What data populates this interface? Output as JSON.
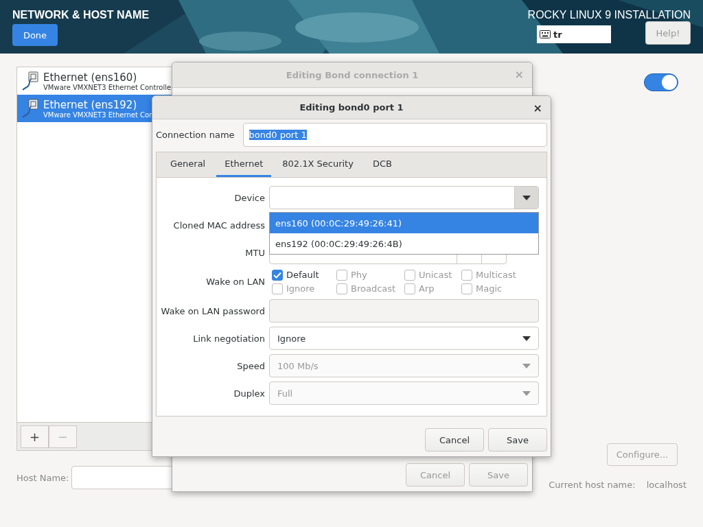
{
  "header": {
    "title": "NETWORK & HOST NAME",
    "done_button": "Done",
    "installer_title": "ROCKY LINUX 9 INSTALLATION",
    "keyboard_layout": "tr",
    "help_button": "Help!"
  },
  "connections": [
    {
      "name": "Ethernet (ens160)",
      "description": "VMware VMXNET3 Ethernet Controlle",
      "selected": false
    },
    {
      "name": "Ethernet (ens192)",
      "description": "VMware VMXNET3 Ethernet Con",
      "selected": true
    }
  ],
  "list_toolbar": {
    "add_button": "+",
    "remove_button": "−",
    "remove_disabled": true
  },
  "network_switch": {
    "on": true
  },
  "configure_button": {
    "label": "Configure...",
    "disabled": true
  },
  "host_name": {
    "label": "Host Name:",
    "current_label": "Current host name:",
    "current_value": "localhost"
  },
  "back_dialog": {
    "title": "Editing Bond connection 1",
    "close": "×",
    "buttons": [
      {
        "label": "Cancel",
        "disabled": true
      },
      {
        "label": "Save",
        "disabled": true
      }
    ]
  },
  "dialog": {
    "title": "Editing bond0 port 1",
    "close": "×",
    "connection_name": {
      "label": "Connection name",
      "value": "bond0 port 1",
      "text_selected": true
    },
    "tabs": [
      {
        "label": "General",
        "selected": false
      },
      {
        "label": "Ethernet",
        "selected": true
      },
      {
        "label": "802.1X Security",
        "selected": false
      },
      {
        "label": "DCB",
        "selected": false
      }
    ],
    "rows": [
      {
        "kind": "combo",
        "label": "Device",
        "expanded": true,
        "disabled": false,
        "options": [
          {
            "label": "ens160 (00:0C:29:49:26:41)",
            "selected": true
          },
          {
            "label": "ens192 (00:0C:29:49:26:4B)",
            "selected": false
          }
        ]
      },
      {
        "kind": "hidden",
        "label": "Cloned MAC address"
      },
      {
        "kind": "spin",
        "label": "MTU"
      },
      {
        "kind": "checks",
        "label": "Wake on LAN",
        "options": [
          {
            "label": "Default",
            "checked": true,
            "disabled": false
          },
          {
            "label": "Phy",
            "checked": false,
            "disabled": true
          },
          {
            "label": "Unicast",
            "checked": false,
            "disabled": true
          },
          {
            "label": "Multicast",
            "checked": false,
            "disabled": true
          },
          {
            "label": "Ignore",
            "checked": false,
            "disabled": true
          },
          {
            "label": "Broadcast",
            "checked": false,
            "disabled": true
          },
          {
            "label": "Arp",
            "checked": false,
            "disabled": true
          },
          {
            "label": "Magic",
            "checked": false,
            "disabled": true
          }
        ]
      },
      {
        "kind": "entry",
        "label": "Wake on LAN password",
        "disabled": true
      },
      {
        "kind": "combo",
        "label": "Link negotiation",
        "value": "Ignore",
        "expanded": false,
        "disabled": false
      },
      {
        "kind": "combo",
        "label": "Speed",
        "value": "100 Mb/s",
        "expanded": false,
        "disabled": true
      },
      {
        "kind": "combo",
        "label": "Duplex",
        "value": "Full",
        "expanded": false,
        "disabled": true
      }
    ],
    "buttons": [
      {
        "label": "Cancel"
      },
      {
        "label": "Save"
      }
    ]
  }
}
